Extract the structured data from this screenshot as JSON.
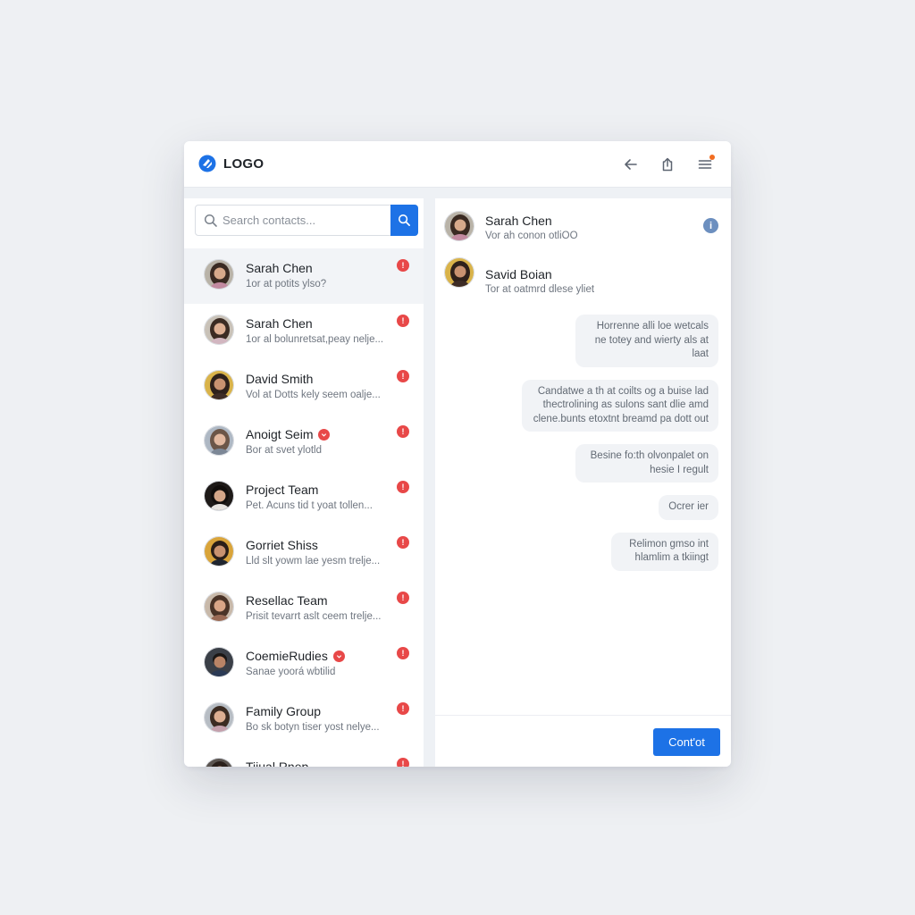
{
  "header": {
    "logo_text": "LOGO",
    "icons": [
      "back-arrow-icon",
      "share-icon",
      "menu-icon"
    ],
    "notification_color": "#f26d21"
  },
  "search": {
    "placeholder": "Search contacts..."
  },
  "contacts": [
    {
      "name": "Sarah Chen",
      "snippet": "1or at potits ylso?",
      "active": true,
      "name_badge": false
    },
    {
      "name": "Sarah Chen",
      "snippet": "1or al bolunretsat,peay nelje...",
      "active": false,
      "name_badge": false
    },
    {
      "name": "David Smith",
      "snippet": "Vol at Dotts kely seem oalje...",
      "active": false,
      "name_badge": false
    },
    {
      "name": "Anoigt Seim",
      "snippet": "Bor at svet ylotld",
      "active": false,
      "name_badge": true
    },
    {
      "name": "Project Team",
      "snippet": "Pet.  Acuns tid t yoat tollen...",
      "active": false,
      "name_badge": false
    },
    {
      "name": "Gorriet Shiss",
      "snippet": "Lld slt yowm lae yesm trelje...",
      "active": false,
      "name_badge": false
    },
    {
      "name": "Resellac Team",
      "snippet": "Prisit tevarrt aslt ceem trelje...",
      "active": false,
      "name_badge": false
    },
    {
      "name": "CoemieRudies",
      "snippet": "Sanae yoorá wbtilid",
      "active": false,
      "name_badge": true
    },
    {
      "name": "Family Group",
      "snippet": "Bo sk botyn tiser yost nelye...",
      "active": false,
      "name_badge": false
    },
    {
      "name": "Tiiual Rnep",
      "snippet": "",
      "active": false,
      "name_badge": false
    }
  ],
  "chat": {
    "header": {
      "name": "Sarah Chen",
      "subtitle": "Vor ah conon otliOO",
      "info_icon": "i"
    },
    "second": {
      "name": "Savid Boian",
      "subtitle": "Tor at oatmrd dlese yliet"
    },
    "messages": [
      "Horrenne alli loe wetcals ne totey and wierty als at laat",
      "Candatwe a th at coilts og a buise lad thectrolining as sulons sant dlie amd clene.bunts etoxtnt breamd pa dott out",
      "Besine fo:th olvonpalet on hesie I regult",
      "Ocrer ier",
      "Relimon gmso int hlamlim a tkiingt"
    ],
    "action_label": "Cont'ot"
  },
  "colors": {
    "accent": "#1d72e6",
    "unread_badge": "#e84848",
    "info": "#6c8fbf"
  }
}
